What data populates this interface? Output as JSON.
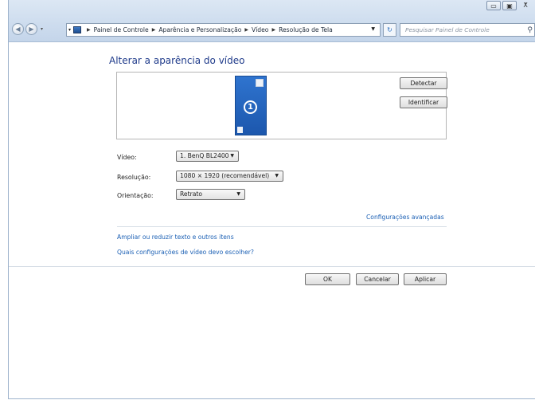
{
  "window": {
    "controls": {
      "minimize": "▭",
      "maximize": "▣",
      "close": "ⵅ"
    }
  },
  "nav": {
    "back_glyph": "◀",
    "forward_glyph": "▶",
    "breadcrumbs": [
      "Painel de Controle",
      "Aparência e Personalização",
      "Vídeo",
      "Resolução de Tela"
    ],
    "refresh_glyph": "↻",
    "search_placeholder": "Pesquisar Painel de Controle"
  },
  "main": {
    "title": "Alterar a aparência do vídeo",
    "monitor_number": "1",
    "detect_label": "Detectar",
    "identify_label": "Identificar",
    "fields": {
      "video": {
        "label": "Vídeo:",
        "value": "1. BenQ BL2400"
      },
      "resolution": {
        "label": "Resolução:",
        "value": "1080 × 1920 (recomendável)"
      },
      "orientation": {
        "label": "Orientação:",
        "value": "Retrato"
      }
    },
    "advanced_link": "Configurações avançadas",
    "link_text_size": "Ampliar ou reduzir texto e outros itens",
    "link_which_settings": "Quais configurações de vídeo devo escolher?"
  },
  "footer": {
    "ok_label": "OK",
    "cancel_label": "Cancelar",
    "apply_label": "Aplicar"
  },
  "colors": {
    "accent_link": "#1a5fb4",
    "title": "#1e3a8a",
    "monitor": "#2f74cf"
  },
  "icons": [
    "back-icon",
    "forward-icon",
    "computer-icon",
    "refresh-icon",
    "search-icon",
    "chevron-down-icon"
  ]
}
